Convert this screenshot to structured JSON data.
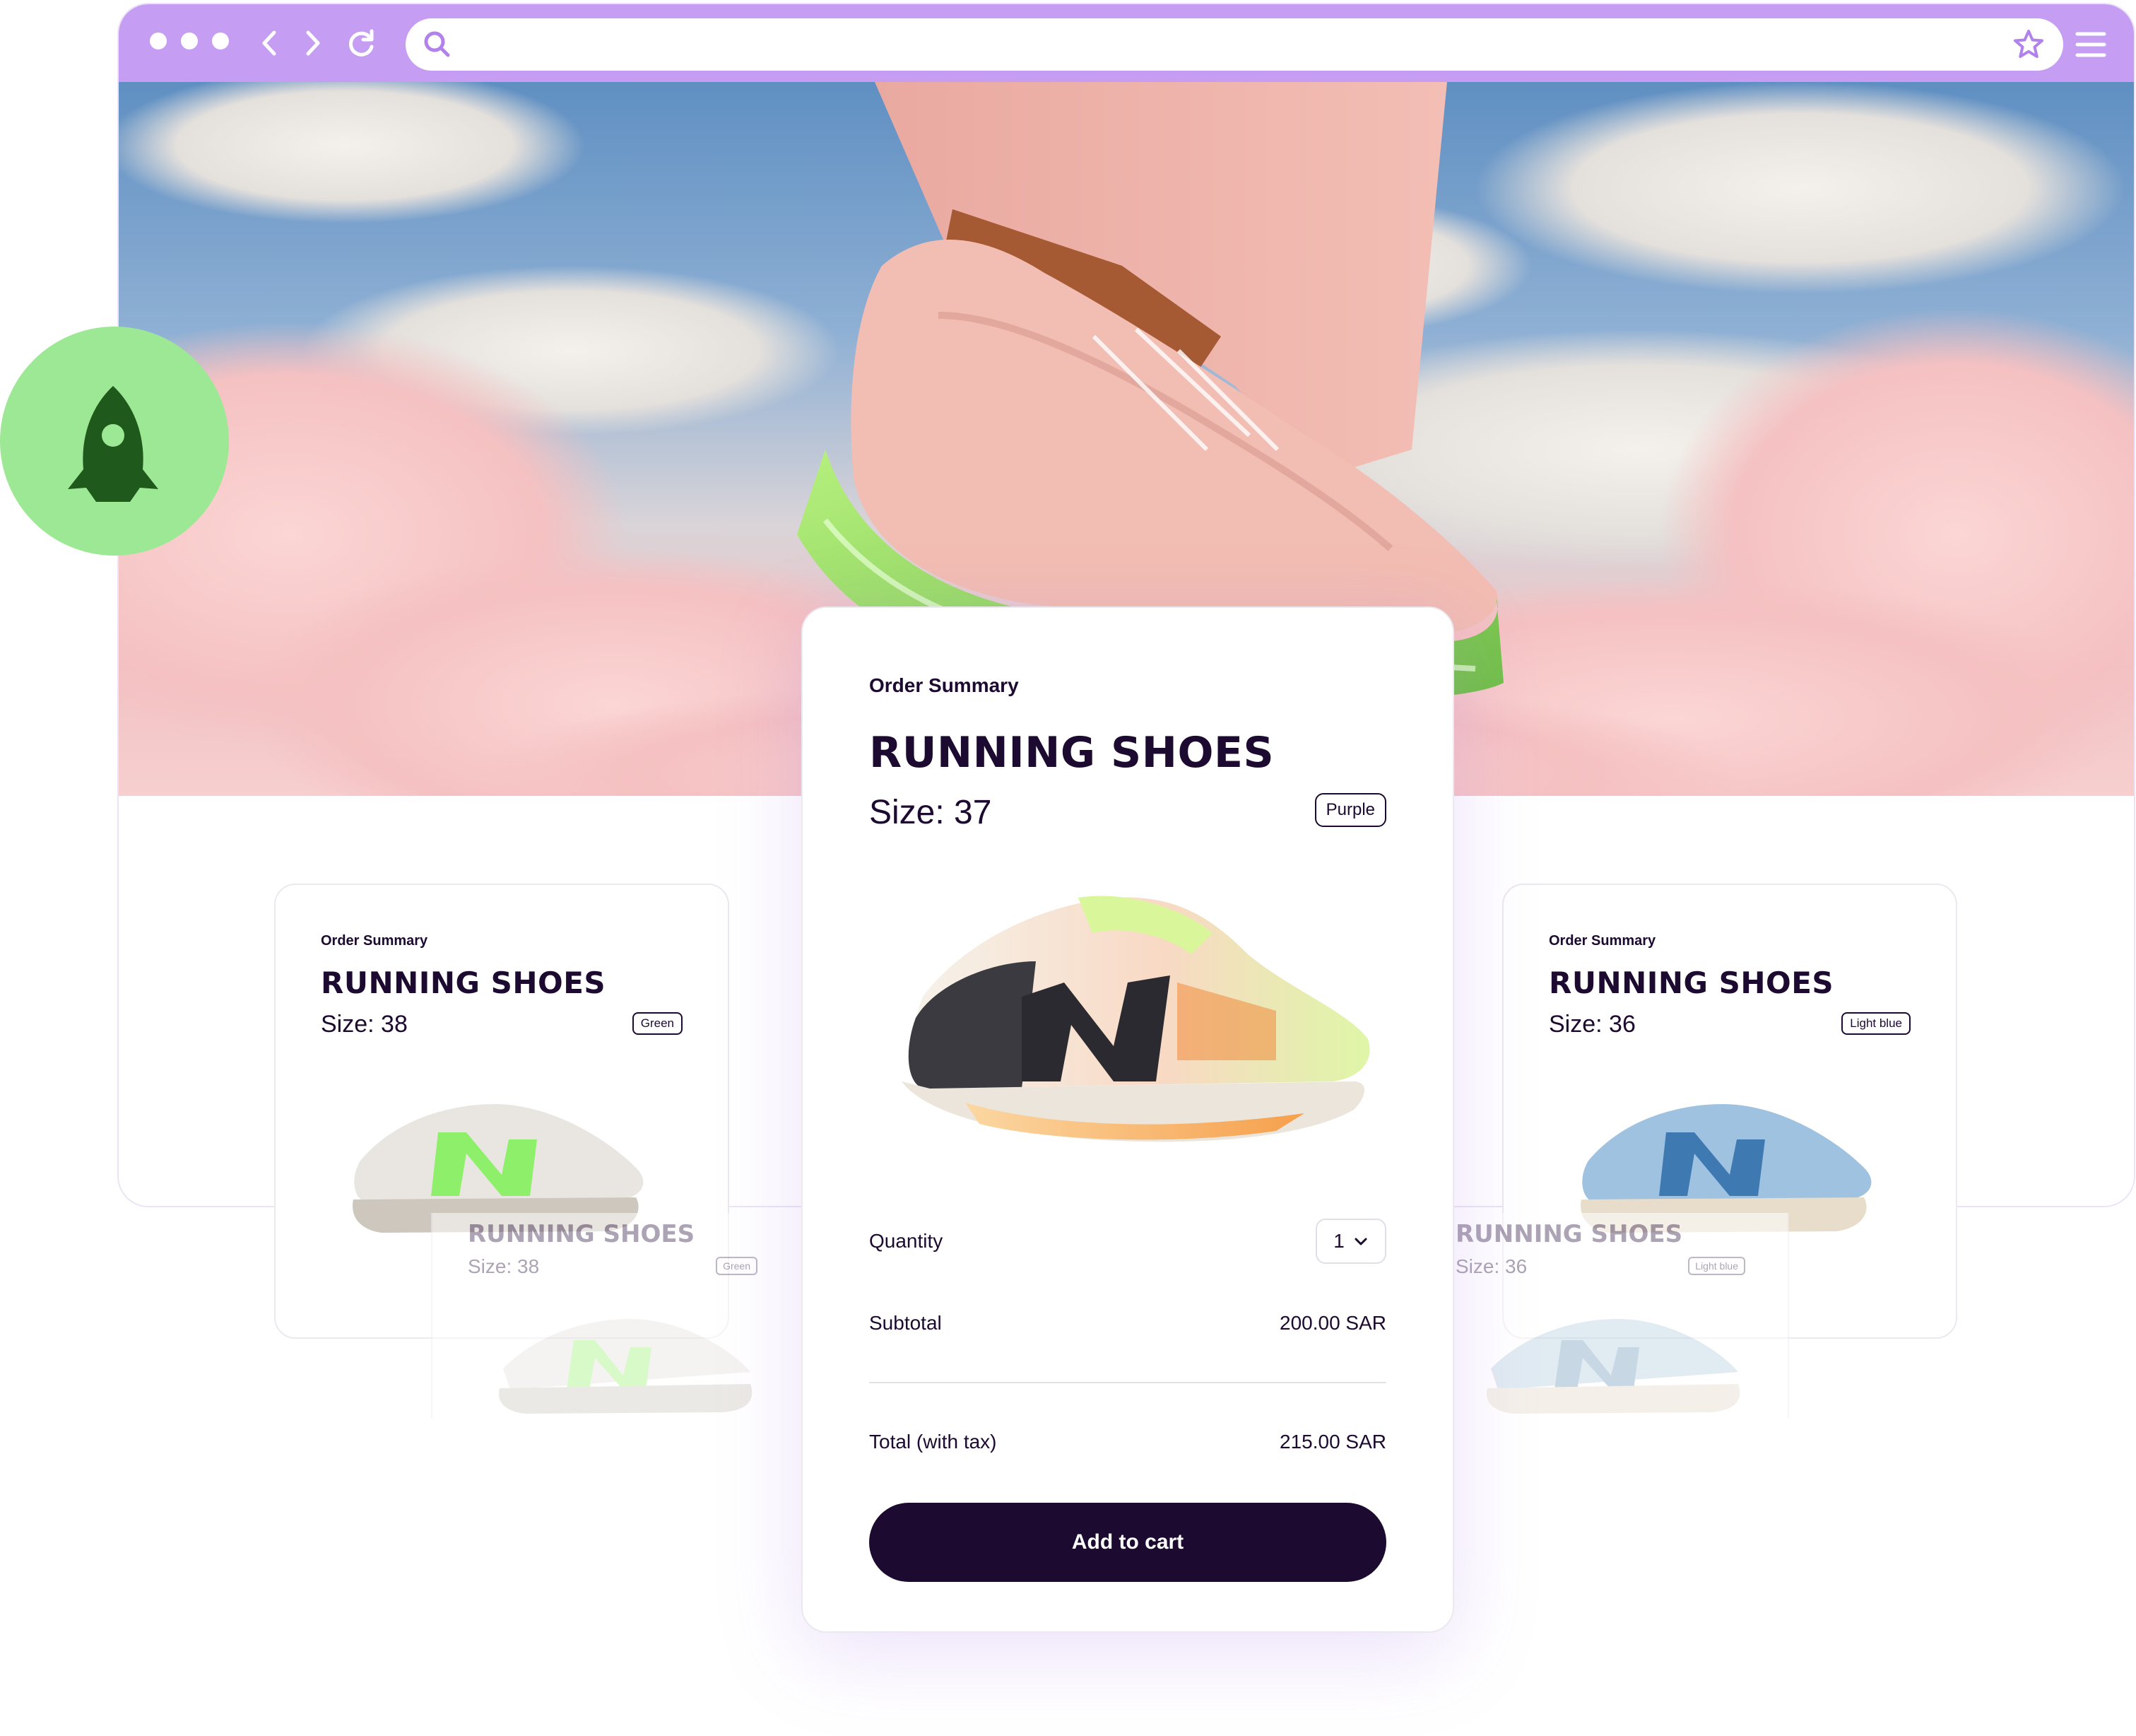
{
  "browser": {
    "address_value": "",
    "accent_color": "#c59df2"
  },
  "icons": {
    "search": "search-icon",
    "back": "chevron-left-icon",
    "forward": "chevron-right-icon",
    "reload": "reload-icon",
    "bookmark": "star-icon",
    "menu": "hamburger-menu-icon",
    "badge": "rocket-icon",
    "quantity_dropdown": "chevron-down-icon"
  },
  "hero": {
    "image": "sneaker-on-clouds"
  },
  "main_card": {
    "eyebrow": "Order Summary",
    "title": "RUNNING SHOES",
    "size": "Size: 37",
    "color_chip": "Purple",
    "quantity_label": "Quantity",
    "quantity_value": "1",
    "subtotal_label": "Subtotal",
    "subtotal_value": "200.00 SAR",
    "total_label": "Total (with tax)",
    "total_value": "215.00 SAR",
    "cta_label": "Add to cart"
  },
  "left_card": {
    "eyebrow": "Order Summary",
    "title": "RUNNING SHOES",
    "size": "Size: 38",
    "color_chip": "Green"
  },
  "right_card": {
    "eyebrow": "Order Summary",
    "title": "RUNNING SHOES",
    "size": "Size: 36",
    "color_chip": "Light blue"
  },
  "left_ghost": {
    "title": "RUNNING SHOES",
    "size": "Size: 38",
    "color_chip": "Green"
  },
  "right_ghost": {
    "title": "RUNNING SHOES",
    "size": "Size: 36",
    "color_chip": "Light blue"
  },
  "colors": {
    "brand_dark": "#1d0a30",
    "badge_green": "#9de894",
    "rocket_dark": "#1f5a1c"
  }
}
